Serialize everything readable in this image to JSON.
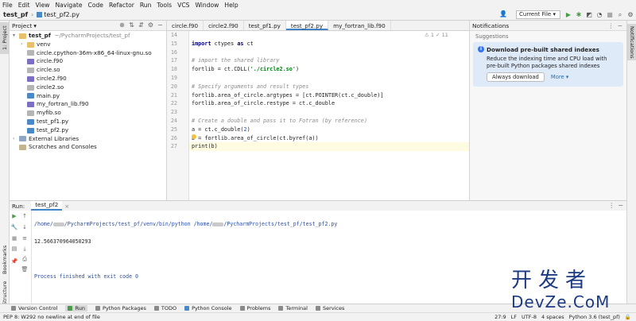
{
  "menu": [
    "File",
    "Edit",
    "View",
    "Navigate",
    "Code",
    "Refactor",
    "Run",
    "Tools",
    "VCS",
    "Window",
    "Help"
  ],
  "toolbar": {
    "project": "test_pf",
    "file": "test_pf2.py",
    "run_config": "Current File"
  },
  "left_tabs": {
    "project": "1: Project",
    "bookmarks": "Bookmarks",
    "structure": "Structure"
  },
  "project_panel": {
    "title": "Project",
    "root": "test_pf",
    "root_path": "~/PycharmProjects/test_pf",
    "items": [
      "venv",
      "circle.cpython-36m-x86_64-linux-gnu.so",
      "circle.f90",
      "circle.so",
      "circle2.f90",
      "circle2.so",
      "main.py",
      "my_fortran_lib.f90",
      "myfib.so",
      "test_pf1.py",
      "test_pf2.py"
    ],
    "external": "External Libraries",
    "scratches": "Scratches and Consoles"
  },
  "editor": {
    "tabs": [
      "circle.f90",
      "circle2.f90",
      "test_pf1.py",
      "test_pf2.py",
      "my_fortran_lib.f90"
    ],
    "active_tab": "test_pf2.py",
    "inspection": "⚠ 1  ✓ 11",
    "line_numbers": [
      "14",
      "15",
      "16",
      "17",
      "18",
      "19",
      "20",
      "21",
      "22",
      "23",
      "24",
      "25",
      "26",
      "27"
    ],
    "lines": {
      "l15_kw": "import",
      "l15_rest": " ctypes ",
      "l15_as": "as",
      "l15_end": " ct",
      "l17": "# import the shared library",
      "l18_a": "fortlib = ct.CDLL(",
      "l18_str": "'./circle2.so'",
      "l18_b": ")",
      "l20": "# Specify arguments and result types",
      "l21": "fortlib.area_of_circle.argtypes = [ct.POINTER(ct.c_double)]",
      "l22": "fortlib.area_of_circle.restype = ct.c_double",
      "l24": "# Create a double and pass it to Fotran (by reference)",
      "l25_a": "a = ct.c_double(",
      "l25_num": "2",
      "l25_b": ")",
      "l26": "b = fortlib.area_of_circle(ct.byref(a))",
      "l27": "print(b)"
    }
  },
  "notifications": {
    "title": "Notifications",
    "section": "Suggestions",
    "card_title": "Download pre-built shared indexes",
    "card_text": "Reduce the indexing time and CPU load with pre-built Python packages shared indexes",
    "btn_always": "Always download",
    "btn_more": "More ▾"
  },
  "right_tab": "Notifications",
  "run": {
    "label": "Run:",
    "tab": "test_pf2",
    "cmd_a": "/home/",
    "cmd_b": "/PycharmProjects/test_pf/venv/bin/python /home/",
    "cmd_c": "/PycharmProjects/test_pf/test_pf2.py",
    "output": "12.566370964050293",
    "finished": "Process finished with exit code 0"
  },
  "bottom_tabs": [
    "Version Control",
    "Run",
    "Python Packages",
    "TODO",
    "Python Console",
    "Problems",
    "Terminal",
    "Services"
  ],
  "status": {
    "message": "PEP 8: W292 no newline at end of file",
    "pos": "27:9",
    "lf": "LF",
    "enc": "UTF-8",
    "indent": "4 spaces",
    "interp": "Python 3.6 (test_pf)"
  },
  "watermark": {
    "top": "开发者",
    "bottom": "DevZe.CoM"
  }
}
